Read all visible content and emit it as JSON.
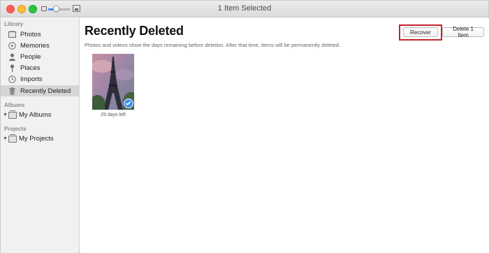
{
  "window": {
    "title": "1 Item Selected",
    "zoom_level": 0.35
  },
  "sidebar": {
    "library_header": "Library",
    "library_items": [
      {
        "label": "Photos",
        "icon": "photos-icon"
      },
      {
        "label": "Memories",
        "icon": "memories-icon"
      },
      {
        "label": "People",
        "icon": "people-icon"
      },
      {
        "label": "Places",
        "icon": "places-icon"
      },
      {
        "label": "Imports",
        "icon": "imports-icon"
      },
      {
        "label": "Recently Deleted",
        "icon": "trash-icon",
        "selected": true
      }
    ],
    "albums_header": "Albums",
    "albums_item": "My Albums",
    "projects_header": "Projects",
    "projects_item": "My Projects"
  },
  "main": {
    "title": "Recently Deleted",
    "subtitle": "Photos and videos show the days remaining before deletion. After that time, items will be permanently deleted.",
    "recover_label": "Recover",
    "delete_label": "Delete 1 Item",
    "photos": [
      {
        "caption": "29 days left",
        "selected": true
      }
    ]
  },
  "colors": {
    "accent": "#3b8ff4",
    "highlight": "#c1272d",
    "selection": "#d6d6d6"
  }
}
